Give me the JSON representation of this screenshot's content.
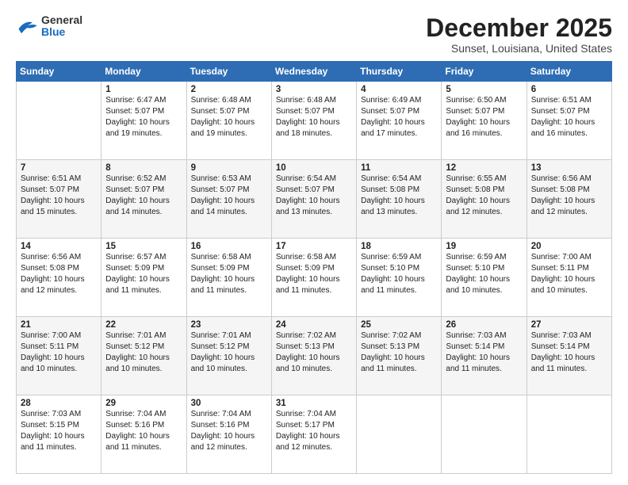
{
  "logo": {
    "general": "General",
    "blue": "Blue"
  },
  "header": {
    "title": "December 2025",
    "subtitle": "Sunset, Louisiana, United States"
  },
  "days_of_week": [
    "Sunday",
    "Monday",
    "Tuesday",
    "Wednesday",
    "Thursday",
    "Friday",
    "Saturday"
  ],
  "weeks": [
    [
      {
        "day": "",
        "content": ""
      },
      {
        "day": "1",
        "content": "Sunrise: 6:47 AM\nSunset: 5:07 PM\nDaylight: 10 hours\nand 19 minutes."
      },
      {
        "day": "2",
        "content": "Sunrise: 6:48 AM\nSunset: 5:07 PM\nDaylight: 10 hours\nand 19 minutes."
      },
      {
        "day": "3",
        "content": "Sunrise: 6:48 AM\nSunset: 5:07 PM\nDaylight: 10 hours\nand 18 minutes."
      },
      {
        "day": "4",
        "content": "Sunrise: 6:49 AM\nSunset: 5:07 PM\nDaylight: 10 hours\nand 17 minutes."
      },
      {
        "day": "5",
        "content": "Sunrise: 6:50 AM\nSunset: 5:07 PM\nDaylight: 10 hours\nand 16 minutes."
      },
      {
        "day": "6",
        "content": "Sunrise: 6:51 AM\nSunset: 5:07 PM\nDaylight: 10 hours\nand 16 minutes."
      }
    ],
    [
      {
        "day": "7",
        "content": "Sunrise: 6:51 AM\nSunset: 5:07 PM\nDaylight: 10 hours\nand 15 minutes."
      },
      {
        "day": "8",
        "content": "Sunrise: 6:52 AM\nSunset: 5:07 PM\nDaylight: 10 hours\nand 14 minutes."
      },
      {
        "day": "9",
        "content": "Sunrise: 6:53 AM\nSunset: 5:07 PM\nDaylight: 10 hours\nand 14 minutes."
      },
      {
        "day": "10",
        "content": "Sunrise: 6:54 AM\nSunset: 5:07 PM\nDaylight: 10 hours\nand 13 minutes."
      },
      {
        "day": "11",
        "content": "Sunrise: 6:54 AM\nSunset: 5:08 PM\nDaylight: 10 hours\nand 13 minutes."
      },
      {
        "day": "12",
        "content": "Sunrise: 6:55 AM\nSunset: 5:08 PM\nDaylight: 10 hours\nand 12 minutes."
      },
      {
        "day": "13",
        "content": "Sunrise: 6:56 AM\nSunset: 5:08 PM\nDaylight: 10 hours\nand 12 minutes."
      }
    ],
    [
      {
        "day": "14",
        "content": "Sunrise: 6:56 AM\nSunset: 5:08 PM\nDaylight: 10 hours\nand 12 minutes."
      },
      {
        "day": "15",
        "content": "Sunrise: 6:57 AM\nSunset: 5:09 PM\nDaylight: 10 hours\nand 11 minutes."
      },
      {
        "day": "16",
        "content": "Sunrise: 6:58 AM\nSunset: 5:09 PM\nDaylight: 10 hours\nand 11 minutes."
      },
      {
        "day": "17",
        "content": "Sunrise: 6:58 AM\nSunset: 5:09 PM\nDaylight: 10 hours\nand 11 minutes."
      },
      {
        "day": "18",
        "content": "Sunrise: 6:59 AM\nSunset: 5:10 PM\nDaylight: 10 hours\nand 11 minutes."
      },
      {
        "day": "19",
        "content": "Sunrise: 6:59 AM\nSunset: 5:10 PM\nDaylight: 10 hours\nand 10 minutes."
      },
      {
        "day": "20",
        "content": "Sunrise: 7:00 AM\nSunset: 5:11 PM\nDaylight: 10 hours\nand 10 minutes."
      }
    ],
    [
      {
        "day": "21",
        "content": "Sunrise: 7:00 AM\nSunset: 5:11 PM\nDaylight: 10 hours\nand 10 minutes."
      },
      {
        "day": "22",
        "content": "Sunrise: 7:01 AM\nSunset: 5:12 PM\nDaylight: 10 hours\nand 10 minutes."
      },
      {
        "day": "23",
        "content": "Sunrise: 7:01 AM\nSunset: 5:12 PM\nDaylight: 10 hours\nand 10 minutes."
      },
      {
        "day": "24",
        "content": "Sunrise: 7:02 AM\nSunset: 5:13 PM\nDaylight: 10 hours\nand 10 minutes."
      },
      {
        "day": "25",
        "content": "Sunrise: 7:02 AM\nSunset: 5:13 PM\nDaylight: 10 hours\nand 11 minutes."
      },
      {
        "day": "26",
        "content": "Sunrise: 7:03 AM\nSunset: 5:14 PM\nDaylight: 10 hours\nand 11 minutes."
      },
      {
        "day": "27",
        "content": "Sunrise: 7:03 AM\nSunset: 5:14 PM\nDaylight: 10 hours\nand 11 minutes."
      }
    ],
    [
      {
        "day": "28",
        "content": "Sunrise: 7:03 AM\nSunset: 5:15 PM\nDaylight: 10 hours\nand 11 minutes."
      },
      {
        "day": "29",
        "content": "Sunrise: 7:04 AM\nSunset: 5:16 PM\nDaylight: 10 hours\nand 11 minutes."
      },
      {
        "day": "30",
        "content": "Sunrise: 7:04 AM\nSunset: 5:16 PM\nDaylight: 10 hours\nand 12 minutes."
      },
      {
        "day": "31",
        "content": "Sunrise: 7:04 AM\nSunset: 5:17 PM\nDaylight: 10 hours\nand 12 minutes."
      },
      {
        "day": "",
        "content": ""
      },
      {
        "day": "",
        "content": ""
      },
      {
        "day": "",
        "content": ""
      }
    ]
  ]
}
